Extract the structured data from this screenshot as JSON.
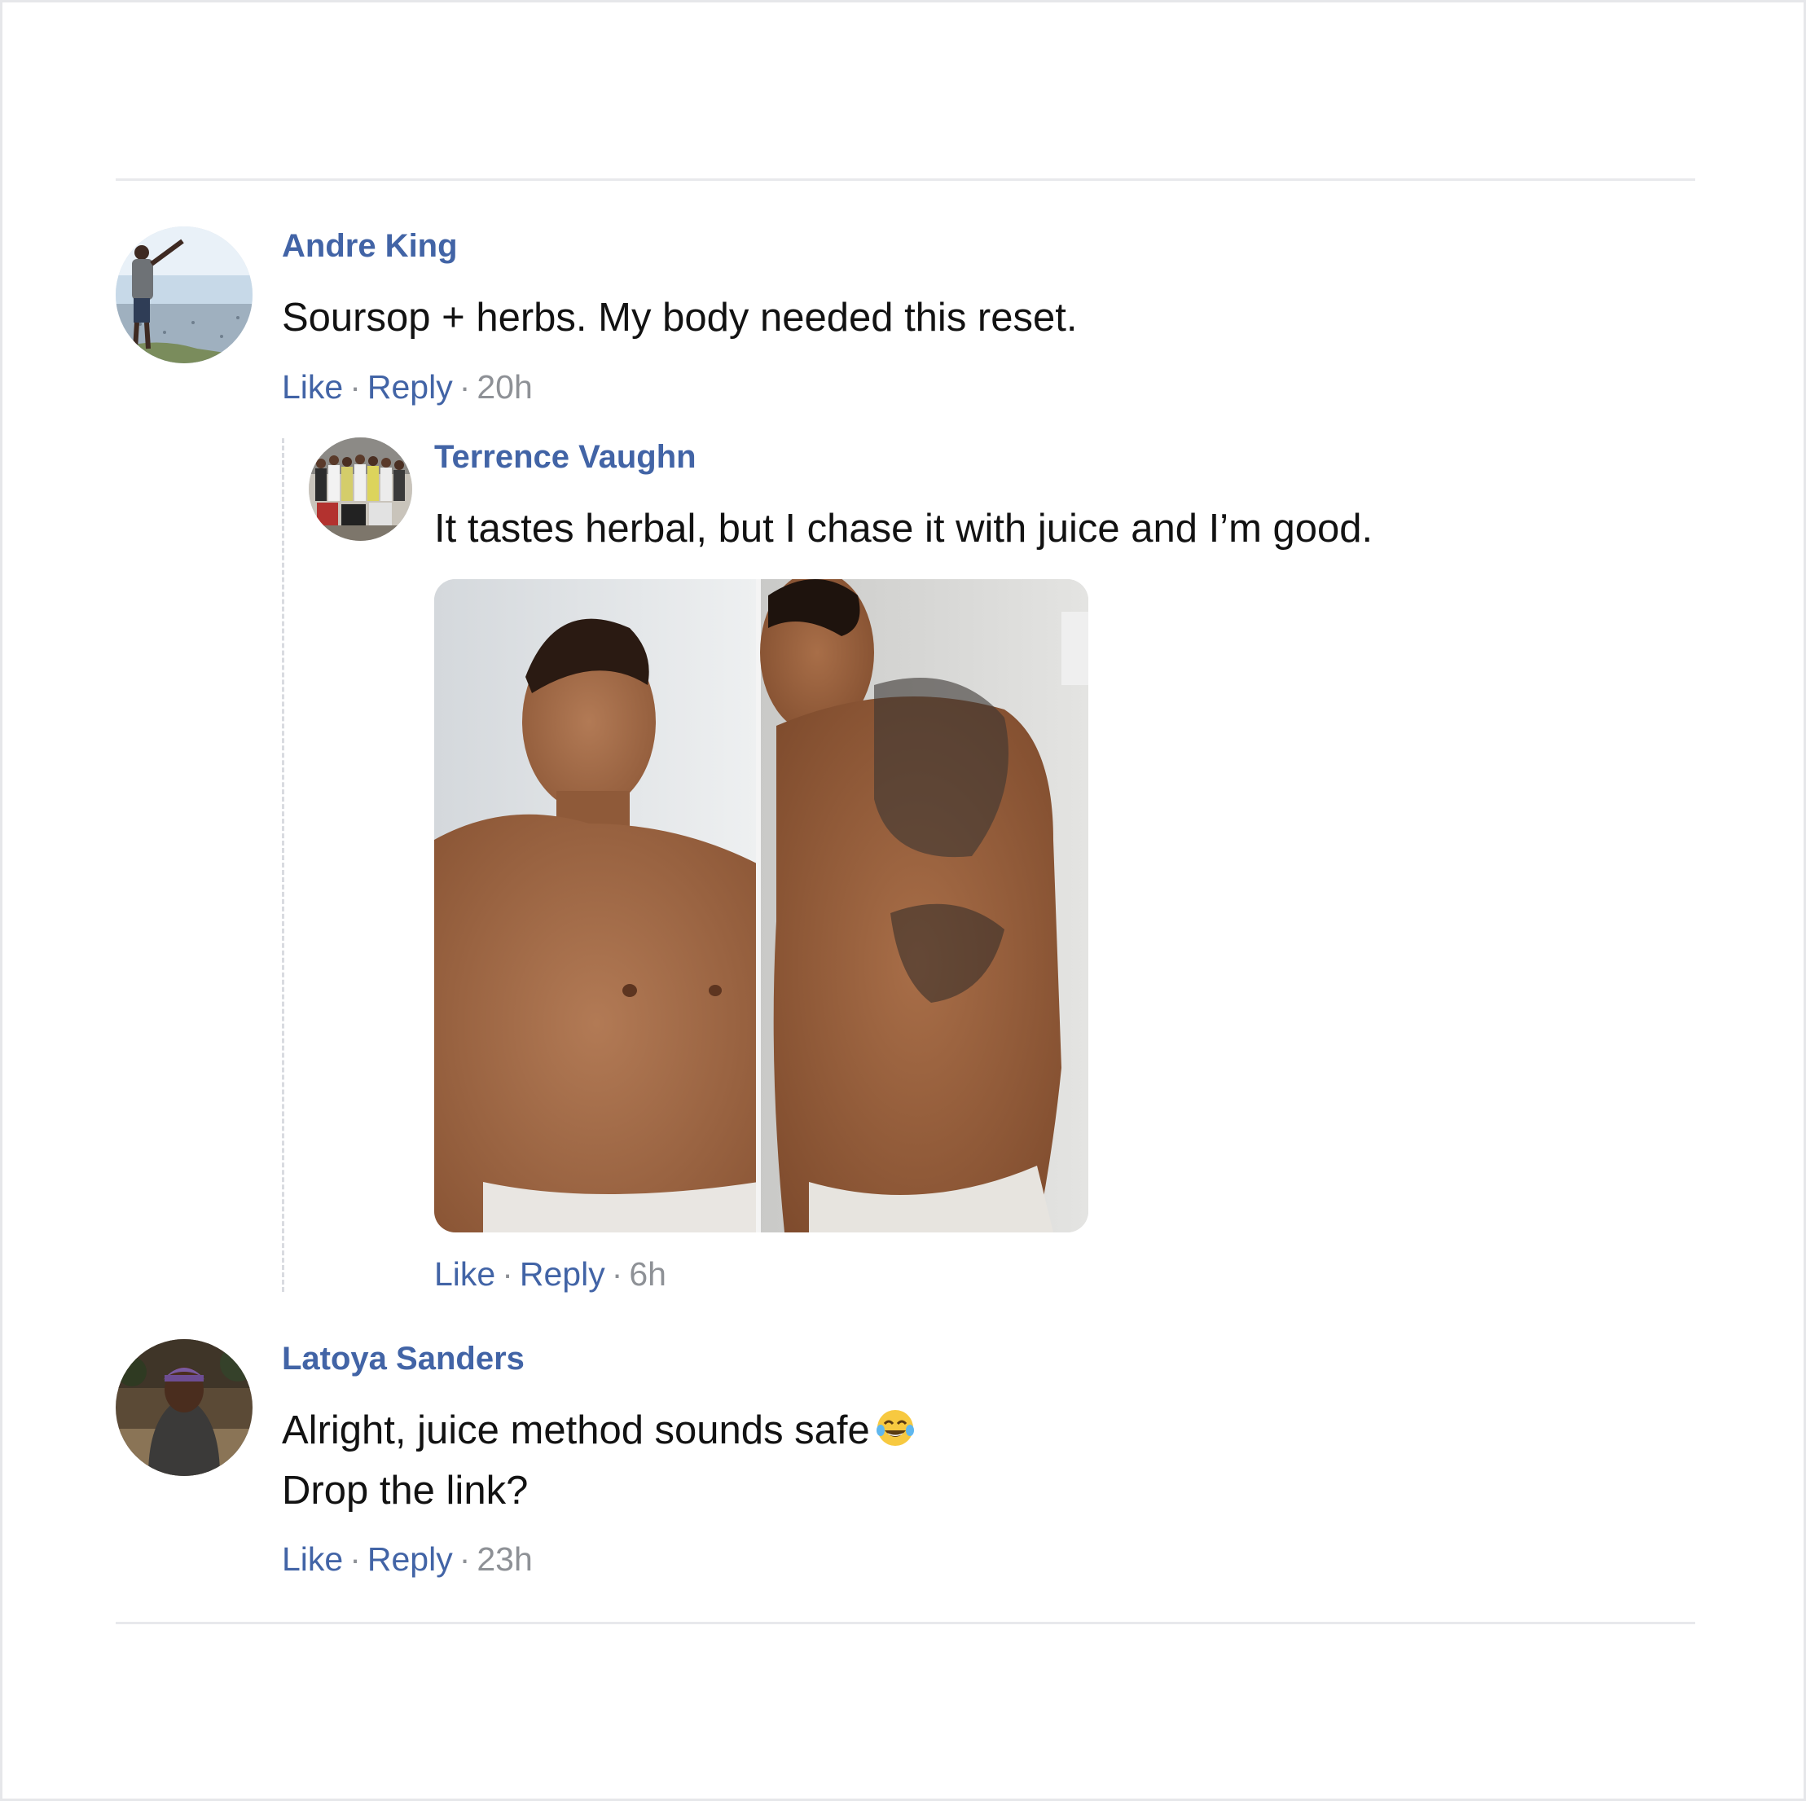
{
  "comments": [
    {
      "author": "Andre King",
      "text_lines": [
        "Soursop + herbs. My body needed this reset."
      ],
      "like_label": "Like",
      "reply_label": "Reply",
      "time": "20h",
      "avatar": "man-on-hilltop-photo",
      "replies": [
        {
          "author": "Terrence Vaughn",
          "text_lines": [
            "It tastes herbal, but I chase it with juice and I’m good."
          ],
          "attachment": "shirtless-man-before-after-photo",
          "like_label": "Like",
          "reply_label": "Reply",
          "time": "6h",
          "avatar": "group-of-people-photo"
        }
      ]
    },
    {
      "author": "Latoya Sanders",
      "text_lines": [
        "Alright, juice method sounds safe",
        "Drop the link?"
      ],
      "emoji": "face-with-tears-of-joy-icon",
      "like_label": "Like",
      "reply_label": "Reply",
      "time": "23h",
      "avatar": "woman-in-hoodie-outdoors-photo"
    }
  ],
  "separator": "·",
  "colors": {
    "name_link": "#4264a6",
    "body_text": "#121212",
    "timestamp": "#8e9196",
    "divider": "#e8e9ec"
  }
}
